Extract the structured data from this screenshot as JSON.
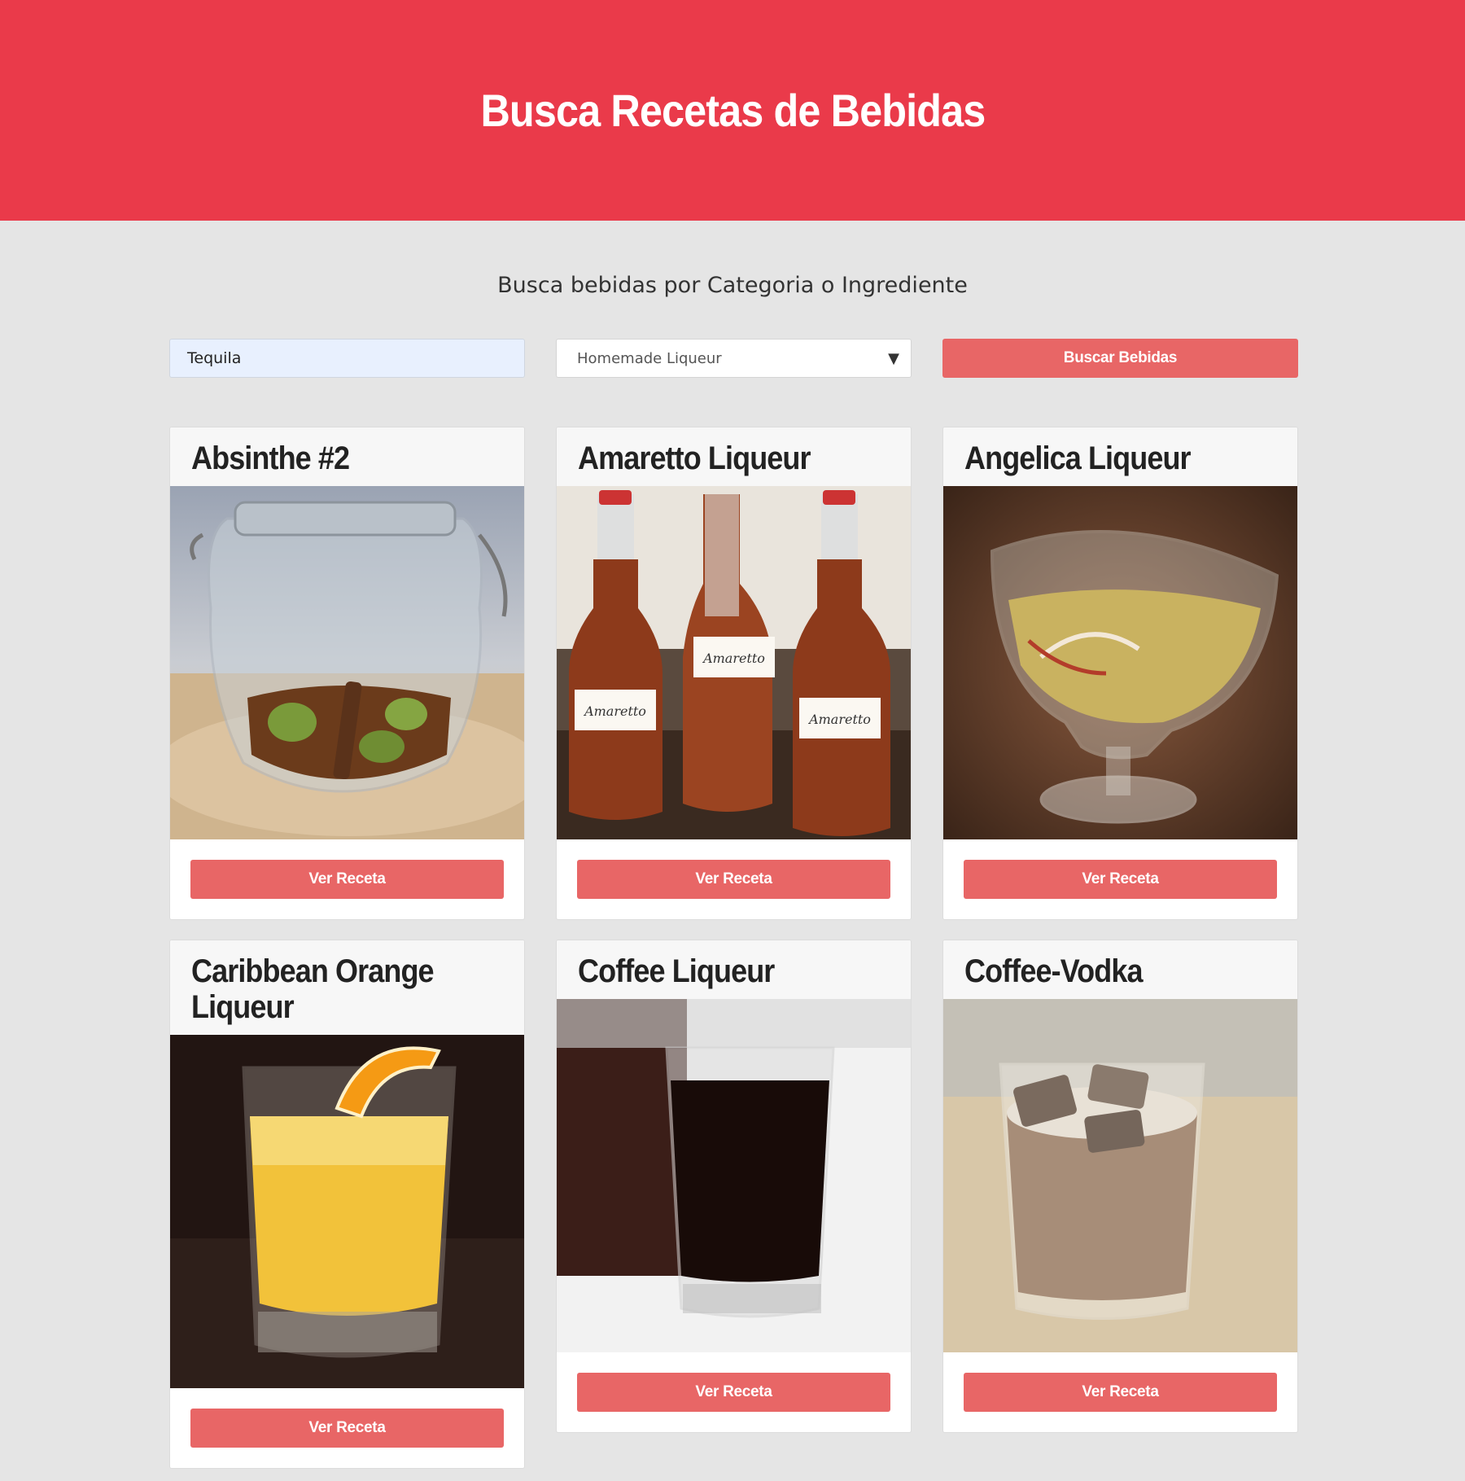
{
  "header": {
    "title": "Busca Recetas de Bebidas"
  },
  "search": {
    "subtitle": "Busca bebidas por Categoria o Ingrediente",
    "ingredient_value": "Tequila",
    "category_value": "Homemade Liqueur",
    "submit_label": "Buscar Bebidas"
  },
  "colors": {
    "brand": "#ea3a4a",
    "button": "#e86666",
    "background": "#e5e5e5"
  },
  "drinks": [
    {
      "name": "Absinthe #2",
      "button": "Ver Receta"
    },
    {
      "name": "Amaretto Liqueur",
      "button": "Ver Receta"
    },
    {
      "name": "Angelica Liqueur",
      "button": "Ver Receta"
    },
    {
      "name": "Caribbean Orange Liqueur",
      "button": "Ver Receta"
    },
    {
      "name": "Coffee Liqueur",
      "button": "Ver Receta"
    },
    {
      "name": "Coffee-Vodka",
      "button": "Ver Receta"
    }
  ],
  "bottle_labels": [
    "Amaretto",
    "Amaretto",
    "Amaretto"
  ]
}
